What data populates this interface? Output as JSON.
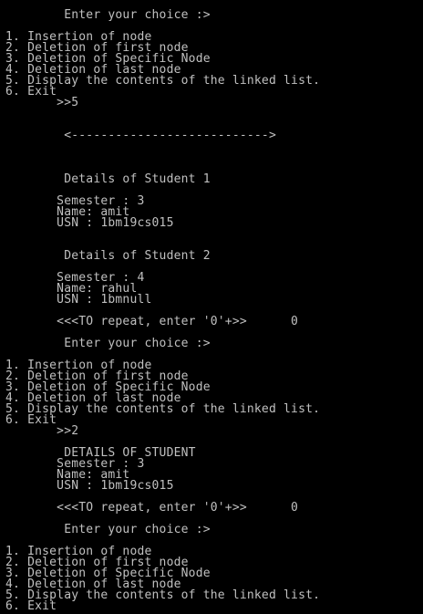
{
  "console": {
    "background": "#000000",
    "text_color": "#c0c0c0",
    "lines": [
      {
        "text": "        Enter your choice :>",
        "row": 0
      },
      {
        "text": "1. Insertion of node",
        "row": 2
      },
      {
        "text": "2. Deletion of first node",
        "row": 3
      },
      {
        "text": "3. Deletion of Specific Node",
        "row": 4
      },
      {
        "text": "4. Deletion of last node",
        "row": 5
      },
      {
        "text": "5. Display the contents of the linked list.",
        "row": 6
      },
      {
        "text": "6. Exit",
        "row": 7
      },
      {
        "text": "       >>5",
        "row": 8
      },
      {
        "text": "        <--------------------------->",
        "row": 11
      },
      {
        "text": "        Details of Student 1",
        "row": 15
      },
      {
        "text": "       Semester : 3",
        "row": 17
      },
      {
        "text": "       Name: amit",
        "row": 18
      },
      {
        "text": "       USN : 1bm19cs015",
        "row": 19
      },
      {
        "text": "        Details of Student 2",
        "row": 22
      },
      {
        "text": "       Semester : 4",
        "row": 24
      },
      {
        "text": "       Name: rahul",
        "row": 25
      },
      {
        "text": "       USN : 1bmnull",
        "row": 26
      },
      {
        "text": "       <<<TO repeat, enter '0'+>>      0",
        "row": 28
      },
      {
        "text": "        Enter your choice :>",
        "row": 30
      },
      {
        "text": "1. Insertion of node",
        "row": 32
      },
      {
        "text": "2. Deletion of first node",
        "row": 33
      },
      {
        "text": "3. Deletion of Specific Node",
        "row": 34
      },
      {
        "text": "4. Deletion of last node",
        "row": 35
      },
      {
        "text": "5. Display the contents of the linked list.",
        "row": 36
      },
      {
        "text": "6. Exit",
        "row": 37
      },
      {
        "text": "       >>2",
        "row": 38
      },
      {
        "text": "        DETAILS OF STUDENT",
        "row": 40
      },
      {
        "text": "       Semester : 3",
        "row": 41
      },
      {
        "text": "       Name: amit",
        "row": 42
      },
      {
        "text": "       USN : 1bm19cs015",
        "row": 43
      },
      {
        "text": "       <<<TO repeat, enter '0'+>>      0",
        "row": 45
      },
      {
        "text": "        Enter your choice :>",
        "row": 47
      },
      {
        "text": "1. Insertion of node",
        "row": 49
      },
      {
        "text": "2. Deletion of first node",
        "row": 50
      },
      {
        "text": "3. Deletion of Specific Node",
        "row": 51
      },
      {
        "text": "4. Deletion of last node",
        "row": 52
      },
      {
        "text": "5. Display the contents of the linked list.",
        "row": 53
      },
      {
        "text": "6. Exit",
        "row": 54
      }
    ]
  }
}
